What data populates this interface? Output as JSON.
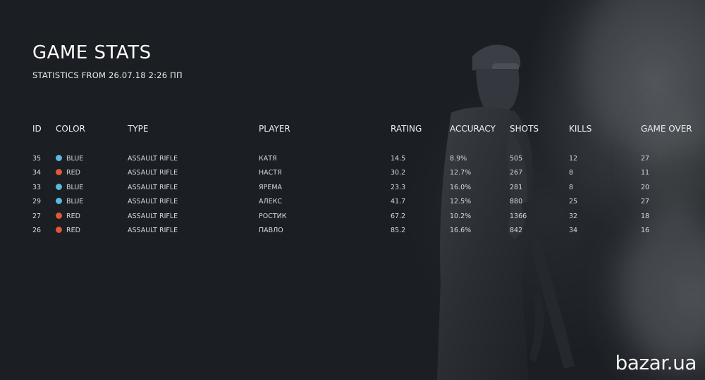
{
  "header": {
    "title": "GAME STATS",
    "subtitle": "STATISTICS FROM 26.07.18 2:26 ПП"
  },
  "columns": {
    "id": "ID",
    "color": "COLOR",
    "type": "TYPE",
    "player": "PLAYER",
    "rating": "RATING",
    "accuracy": "ACCURACY",
    "shots": "SHOTS",
    "kills": "KILLS",
    "game_over": "GAME OVER"
  },
  "colors": {
    "blue": "#5bb8e0",
    "red": "#e0573a",
    "background": "#1b1e22"
  },
  "rows": [
    {
      "id": "35",
      "color": "BLUE",
      "type": "ASSAULT RIFLE",
      "player": "КАТЯ",
      "rating": "14.5",
      "accuracy": "8.9%",
      "shots": "505",
      "kills": "12",
      "game_over": "27"
    },
    {
      "id": "34",
      "color": "RED",
      "type": "ASSAULT RIFLE",
      "player": "НАСТЯ",
      "rating": "30.2",
      "accuracy": "12.7%",
      "shots": "267",
      "kills": "8",
      "game_over": "11"
    },
    {
      "id": "33",
      "color": "BLUE",
      "type": "ASSAULT RIFLE",
      "player": "ЯРЕМА",
      "rating": "23.3",
      "accuracy": "16.0%",
      "shots": "281",
      "kills": "8",
      "game_over": "20"
    },
    {
      "id": "29",
      "color": "BLUE",
      "type": "ASSAULT RIFLE",
      "player": "АЛЕКС",
      "rating": "41.7",
      "accuracy": "12.5%",
      "shots": "880",
      "kills": "25",
      "game_over": "27"
    },
    {
      "id": "27",
      "color": "RED",
      "type": "ASSAULT RIFLE",
      "player": "РОСТИК",
      "rating": "67.2",
      "accuracy": "10.2%",
      "shots": "1366",
      "kills": "32",
      "game_over": "18"
    },
    {
      "id": "26",
      "color": "RED",
      "type": "ASSAULT RIFLE",
      "player": "ПАВЛО",
      "rating": "85.2",
      "accuracy": "16.6%",
      "shots": "842",
      "kills": "34",
      "game_over": "16"
    }
  ],
  "watermark": "bazar.ua"
}
